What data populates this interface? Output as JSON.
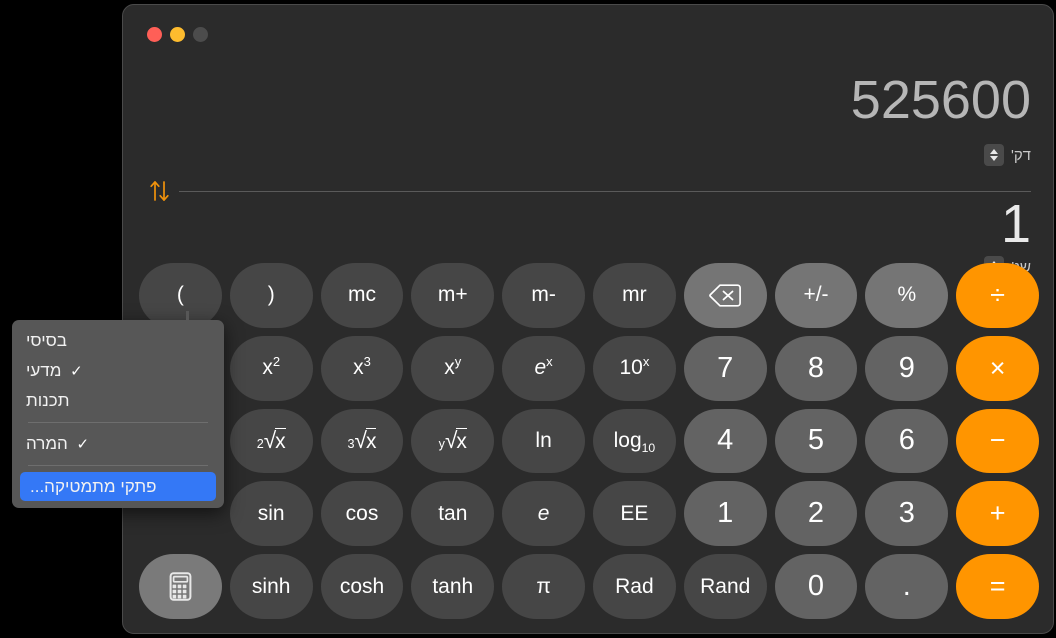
{
  "window": {
    "traffic_lights": [
      "close",
      "minimize",
      "zoom-disabled"
    ]
  },
  "display": {
    "top_value": "525600",
    "top_unit": "דק'",
    "bottom_value": "1",
    "bottom_unit": "שנ'",
    "swap_icon": "swap-vertical-arrows-icon",
    "accent_color": "#f0920c"
  },
  "keypad": {
    "rows": [
      [
        {
          "label": "(",
          "kind": "fn",
          "name": "key-open-paren"
        },
        {
          "label": ")",
          "kind": "fn",
          "name": "key-close-paren"
        },
        {
          "label": "mc",
          "kind": "fn",
          "name": "key-memory-clear"
        },
        {
          "label": "m+",
          "kind": "fn",
          "name": "key-memory-add"
        },
        {
          "label": "m-",
          "kind": "fn",
          "name": "key-memory-subtract"
        },
        {
          "label": "mr",
          "kind": "fn",
          "name": "key-memory-recall"
        },
        {
          "label": "",
          "kind": "util",
          "name": "key-delete",
          "icon": "backspace-delete-icon"
        },
        {
          "label": "+/-",
          "kind": "util",
          "name": "key-sign-toggle"
        },
        {
          "label": "%",
          "kind": "util",
          "name": "key-percent"
        },
        {
          "label": "÷",
          "kind": "op",
          "name": "key-divide"
        }
      ],
      [
        {
          "label": "x²",
          "kind": "fn",
          "name": "key-x-squared"
        },
        {
          "label": "x³",
          "kind": "fn",
          "name": "key-x-cubed"
        },
        {
          "label": "xʸ",
          "kind": "fn",
          "name": "key-x-power-y"
        },
        {
          "label": "eˣ",
          "kind": "fn",
          "name": "key-e-power-x"
        },
        {
          "label": "10ˣ",
          "kind": "fn",
          "name": "key-ten-power-x"
        },
        {
          "label": "7",
          "kind": "num",
          "name": "key-7"
        },
        {
          "label": "8",
          "kind": "num",
          "name": "key-8"
        },
        {
          "label": "9",
          "kind": "num",
          "name": "key-9"
        },
        {
          "label": "×",
          "kind": "op",
          "name": "key-multiply"
        }
      ],
      [
        {
          "label": "²√x",
          "kind": "fn",
          "name": "key-square-root"
        },
        {
          "label": "³√x",
          "kind": "fn",
          "name": "key-cube-root"
        },
        {
          "label": "ʸ√x",
          "kind": "fn",
          "name": "key-y-root"
        },
        {
          "label": "ln",
          "kind": "fn",
          "name": "key-natural-log"
        },
        {
          "label": "log₁₀",
          "kind": "fn",
          "name": "key-log-base-10"
        },
        {
          "label": "4",
          "kind": "num",
          "name": "key-4"
        },
        {
          "label": "5",
          "kind": "num",
          "name": "key-5"
        },
        {
          "label": "6",
          "kind": "num",
          "name": "key-6"
        },
        {
          "label": "−",
          "kind": "op",
          "name": "key-subtract"
        }
      ],
      [
        {
          "label": "sin",
          "kind": "fn",
          "name": "key-sin"
        },
        {
          "label": "cos",
          "kind": "fn",
          "name": "key-cos"
        },
        {
          "label": "tan",
          "kind": "fn",
          "name": "key-tan"
        },
        {
          "label": "e",
          "kind": "fn",
          "name": "key-euler-e"
        },
        {
          "label": "EE",
          "kind": "fn",
          "name": "key-exponent-ee"
        },
        {
          "label": "1",
          "kind": "num",
          "name": "key-1"
        },
        {
          "label": "2",
          "kind": "num",
          "name": "key-2"
        },
        {
          "label": "3",
          "kind": "num",
          "name": "key-3"
        },
        {
          "label": "+",
          "kind": "op",
          "name": "key-add"
        }
      ],
      [
        {
          "label": "",
          "kind": "mode",
          "name": "key-calculator-mode",
          "icon": "calculator-icon"
        },
        {
          "label": "sinh",
          "kind": "fn",
          "name": "key-sinh"
        },
        {
          "label": "cosh",
          "kind": "fn",
          "name": "key-cosh"
        },
        {
          "label": "tanh",
          "kind": "fn",
          "name": "key-tanh"
        },
        {
          "label": "π",
          "kind": "fn",
          "name": "key-pi"
        },
        {
          "label": "Rad",
          "kind": "fn",
          "name": "key-rad"
        },
        {
          "label": "Rand",
          "kind": "fn",
          "name": "key-rand"
        },
        {
          "label": "0",
          "kind": "num",
          "name": "key-0"
        },
        {
          "label": ".",
          "kind": "num",
          "name": "key-decimal-point"
        },
        {
          "label": "=",
          "kind": "op",
          "name": "key-equals"
        }
      ]
    ]
  },
  "context_menu": {
    "items": [
      {
        "label": "בסיסי",
        "checked": false,
        "type": "item",
        "name": "menu-item-basic"
      },
      {
        "label": "מדעי",
        "checked": true,
        "type": "item",
        "name": "menu-item-scientific"
      },
      {
        "label": "תכנות",
        "checked": false,
        "type": "item",
        "name": "menu-item-programmer"
      },
      {
        "type": "separator",
        "name": "menu-separator-1"
      },
      {
        "label": "המרה",
        "checked": true,
        "type": "item",
        "name": "menu-item-convert"
      },
      {
        "type": "separator",
        "name": "menu-separator-2"
      },
      {
        "label": "פתקי מתמטיקה...",
        "checked": false,
        "type": "item",
        "highlighted": true,
        "name": "menu-item-math-notes"
      }
    ],
    "checkmark": "✓",
    "highlight_color": "#3478f6"
  },
  "colors": {
    "window_bg": "#2b2b2b",
    "key_function": "#464646",
    "key_number": "#636363",
    "key_utility": "#757575",
    "key_operator": "#ff9500",
    "accent_orange": "#f0920c"
  }
}
